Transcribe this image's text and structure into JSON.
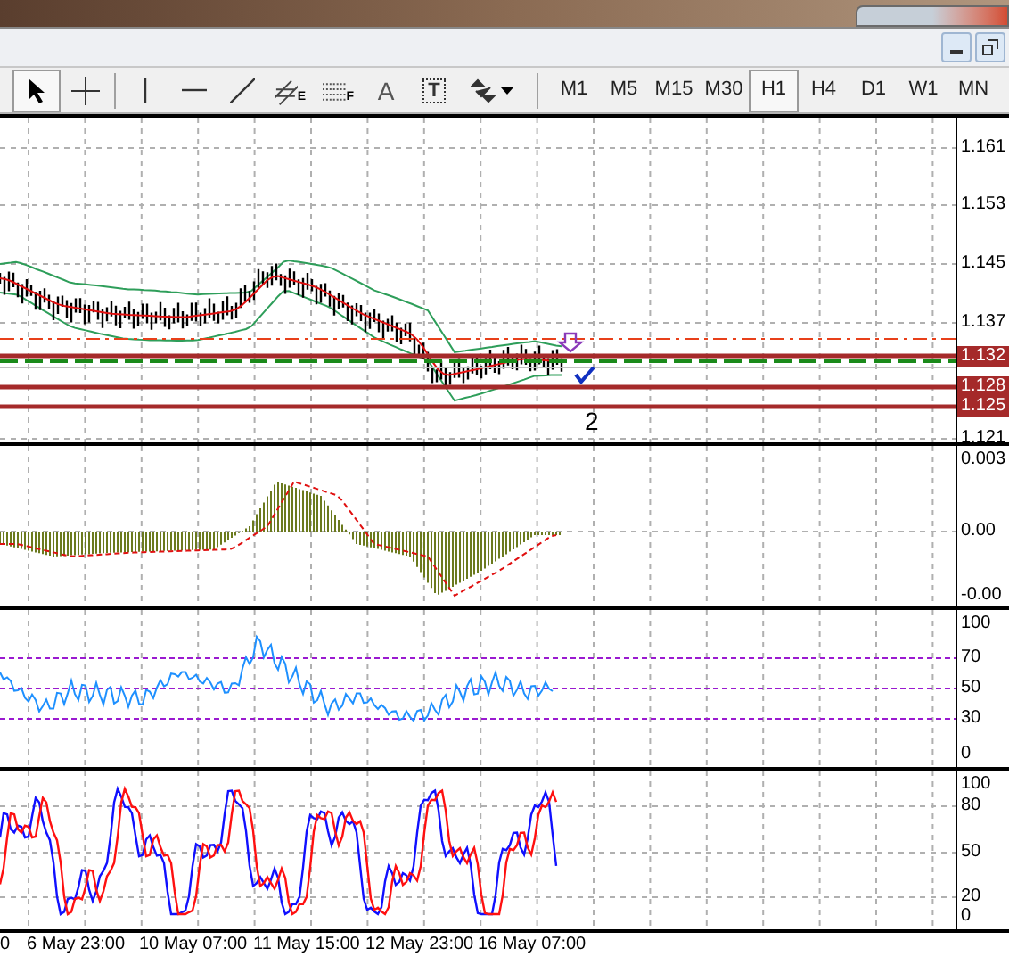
{
  "window_controls": [
    {
      "kind": "minimize"
    },
    {
      "kind": "restore"
    }
  ],
  "toolbar": {
    "tools": [
      {
        "kind": "cursor",
        "selected": true
      },
      {
        "kind": "crosshair",
        "selected": false
      },
      {
        "kind": "vline",
        "selected": false
      },
      {
        "kind": "hline",
        "selected": false
      },
      {
        "kind": "trendline",
        "selected": false
      },
      {
        "kind": "channel",
        "label": "E",
        "selected": false
      },
      {
        "kind": "levels",
        "label": "F",
        "selected": false
      },
      {
        "kind": "text",
        "label": "A",
        "selected": false
      },
      {
        "kind": "textlabel",
        "label": "T",
        "selected": false
      },
      {
        "kind": "arrows",
        "selected": false
      }
    ],
    "timeframes": [
      {
        "label": "M1",
        "selected": false
      },
      {
        "label": "M5",
        "selected": false
      },
      {
        "label": "M15",
        "selected": false
      },
      {
        "label": "M30",
        "selected": false
      },
      {
        "label": "H1",
        "selected": true
      },
      {
        "label": "H4",
        "selected": false
      },
      {
        "label": "D1",
        "selected": false
      },
      {
        "label": "W1",
        "selected": false
      },
      {
        "label": "MN",
        "selected": false
      }
    ]
  },
  "main_chart": {
    "price_axis": [
      "1.161",
      "1.153",
      "1.145",
      "1.137",
      "1.121"
    ],
    "price_tags": [
      "1.132",
      "1.128",
      "1.125"
    ],
    "annotation": "2"
  },
  "macd": {
    "axis": [
      "0.003",
      "0.00",
      "-0.00"
    ]
  },
  "rsi": {
    "axis": [
      "100",
      "70",
      "50",
      "30",
      "0"
    ]
  },
  "stochastic": {
    "axis": [
      "100",
      "80",
      "50",
      "20",
      "0"
    ]
  },
  "time_axis": [
    "0",
    "6 May 23:00",
    "10 May 07:00",
    "11 May 15:00",
    "12 May 23:00",
    "16 May 07:00"
  ]
}
